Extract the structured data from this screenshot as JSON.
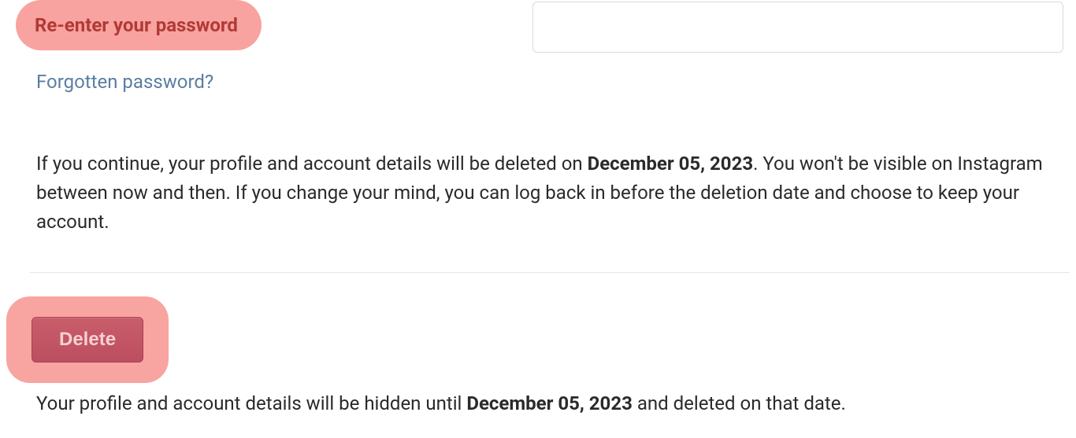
{
  "password_section": {
    "label": "Re-enter your password",
    "input_value": "",
    "input_placeholder": ""
  },
  "forgot_link": "Forgotten password?",
  "info": {
    "prefix": "If you continue, your profile and account details will be deleted on ",
    "date": "December 05, 2023",
    "suffix": ". You won't be visible on Instagram between now and then. If you change your mind, you can log back in before the deletion date and choose to keep your account."
  },
  "delete_button_label": "Delete",
  "footer": {
    "prefix": "Your profile and account details will be hidden until ",
    "date": "December 05, 2023",
    "suffix": " and deleted on that date."
  }
}
